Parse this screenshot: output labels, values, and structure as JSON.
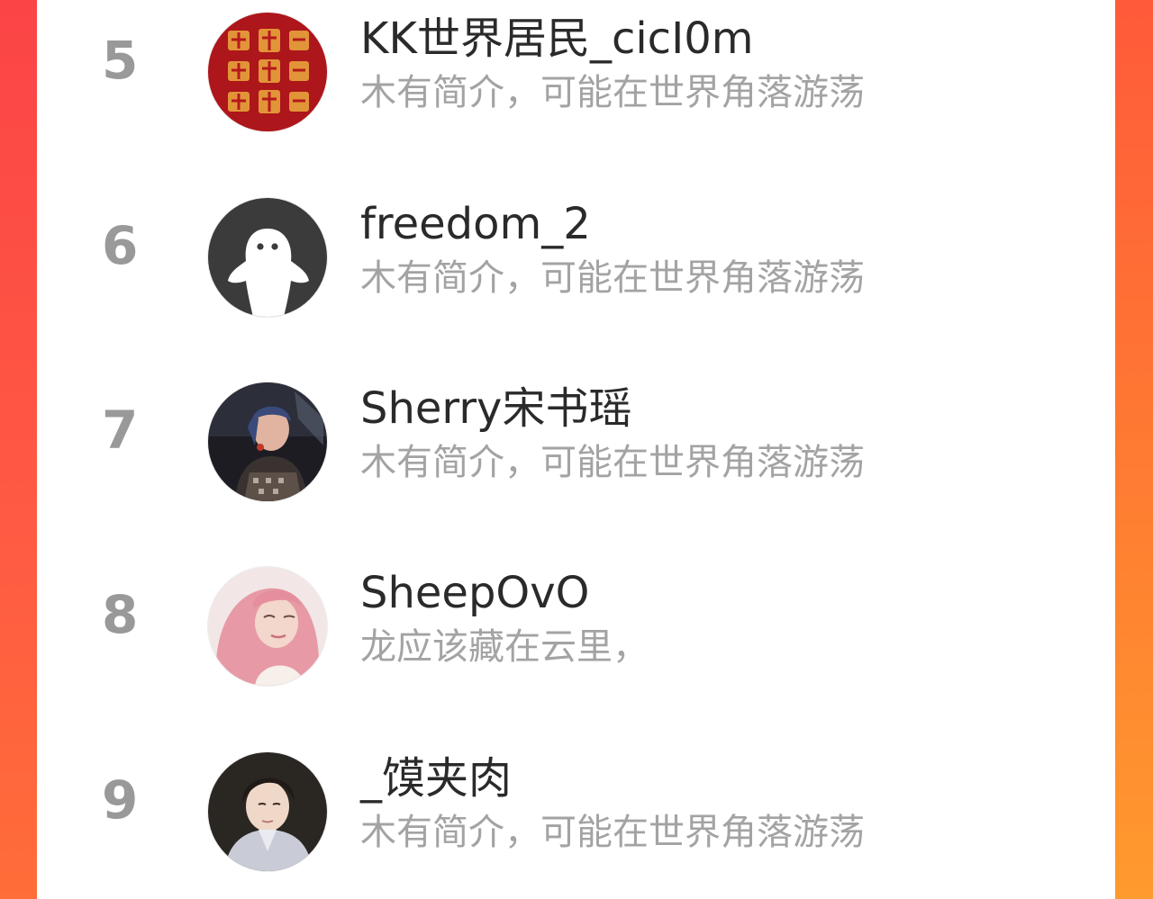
{
  "list": {
    "items": [
      {
        "rank": "5",
        "name": "KK世界居民_cicI0m",
        "bio": "木有简介，可能在世界角落游荡",
        "avatar": "red-fortune-avatar"
      },
      {
        "rank": "6",
        "name": "freedom_2",
        "bio": "木有简介，可能在世界角落游荡",
        "avatar": "default-ghost-avatar"
      },
      {
        "rank": "7",
        "name": "Sherry宋书瑶",
        "bio": "木有简介，可能在世界角落游荡",
        "avatar": "photo-avatar"
      },
      {
        "rank": "8",
        "name": "SheepOvO",
        "bio": "龙应该藏在云里，",
        "avatar": "photo-avatar"
      },
      {
        "rank": "9",
        "name": "_馍夹肉",
        "bio": "木有简介，可能在世界角落游荡",
        "avatar": "photo-avatar"
      }
    ]
  },
  "colors": {
    "rank": "#999999",
    "name": "#2a2a2a",
    "bio": "#a3a3a3",
    "edge_left": "#fb4446",
    "edge_right": "#ff7a32"
  }
}
